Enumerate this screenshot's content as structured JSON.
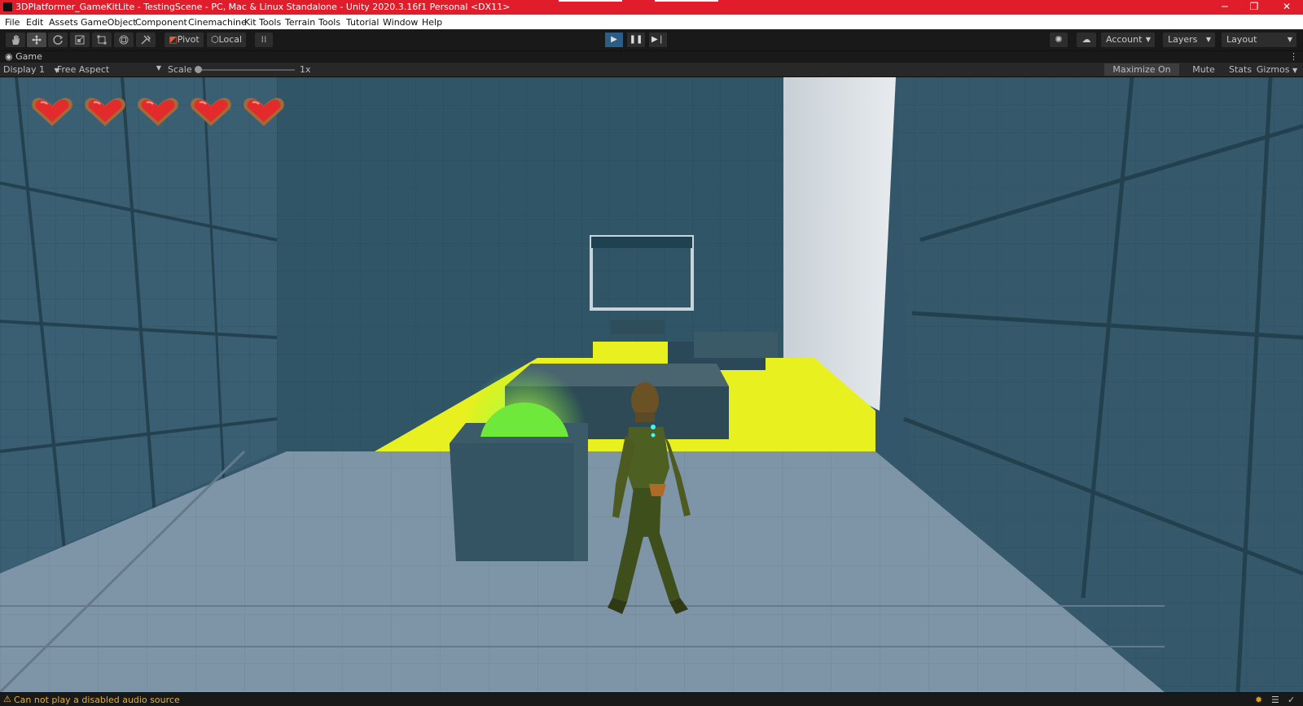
{
  "window": {
    "title": "3DPlatformer_GameKitLite - TestingScene - PC, Mac & Linux Standalone - Unity 2020.3.16f1 Personal <DX11>",
    "minimize": "─",
    "restore": "❐",
    "close": "✕"
  },
  "menu": [
    "File",
    "Edit",
    "Assets",
    "GameObject",
    "Component",
    "Cinemachine",
    "Kit Tools",
    "Terrain",
    "Tools",
    "Tutorial",
    "Window",
    "Help"
  ],
  "toolbar": {
    "tools": [
      "hand-tool-icon",
      "move-tool-icon",
      "rotate-tool-icon",
      "scale-tool-icon",
      "rect-tool-icon",
      "transform-tool-icon",
      "custom-tool-icon"
    ],
    "pivot": "Pivot",
    "local": "Local",
    "play_state": "playing",
    "account": "Account",
    "layers": "Layers",
    "layout": "Layout"
  },
  "panel": {
    "tab": "Game"
  },
  "gamebar": {
    "display": "Display 1",
    "aspect": "Free Aspect",
    "scale_label": "Scale",
    "scale_value": "1x",
    "maximize": "Maximize On Play",
    "mute": "Mute Audio",
    "stats": "Stats",
    "gizmos": "Gizmos"
  },
  "hud": {
    "health": 5,
    "max_health": 5
  },
  "status": {
    "message": "Can not play a disabled audio source"
  },
  "colors": {
    "titlebar": "#e21d2b",
    "play_active": "#2c5d87",
    "lava": "#e8f020",
    "switch": "#6ee83a"
  }
}
